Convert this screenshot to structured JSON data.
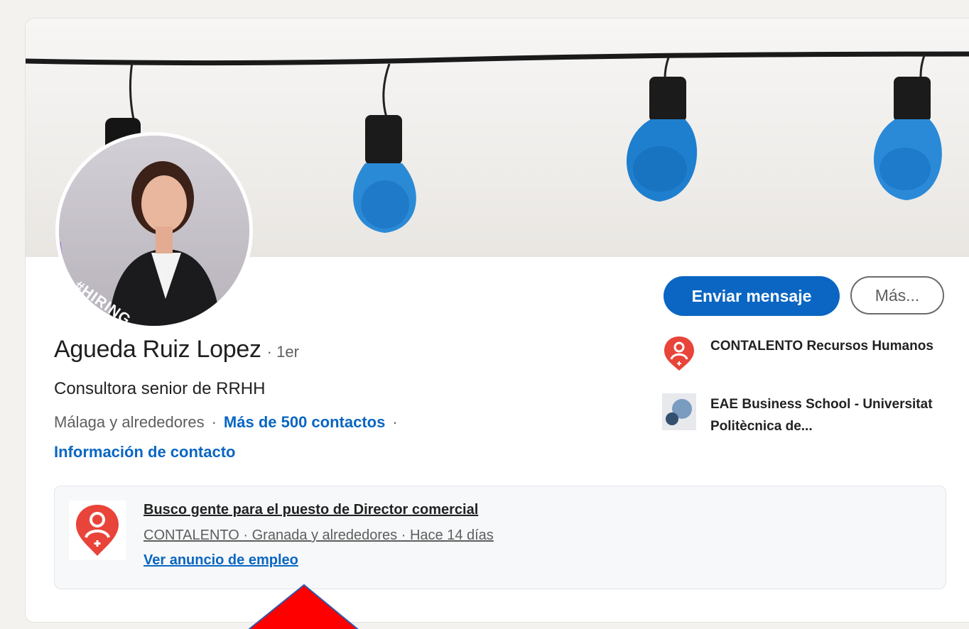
{
  "profile": {
    "name": "Agueda Ruiz Lopez",
    "degree": "· 1er",
    "headline": "Consultora senior de RRHH",
    "location": "Málaga y alrededores",
    "separator": "·",
    "connections": "Más de 500 contactos",
    "contact_info": "Información de contacto",
    "hiring_badge": "#HIRING"
  },
  "actions": {
    "message_label": "Enviar mensaje",
    "more_label": "Más..."
  },
  "sidebar": {
    "items": [
      {
        "label": "CONTALENTO Recursos Humanos",
        "icon": "contalento-logo"
      },
      {
        "label": "EAE Business School - Universitat Politècnica de...",
        "icon": "eae-logo"
      }
    ]
  },
  "job": {
    "title": "Busco gente para el puesto de Director comercial",
    "subtitle": "CONTALENTO · Granada y alrededores · Hace 14 días",
    "link": "Ver anuncio de empleo",
    "icon": "contalento-logo"
  },
  "colors": {
    "accent": "#0a66c2",
    "hiring_purple": "#7b3fd0",
    "brand_red": "#e8443a",
    "annotation_arrow": "#ff0000"
  }
}
